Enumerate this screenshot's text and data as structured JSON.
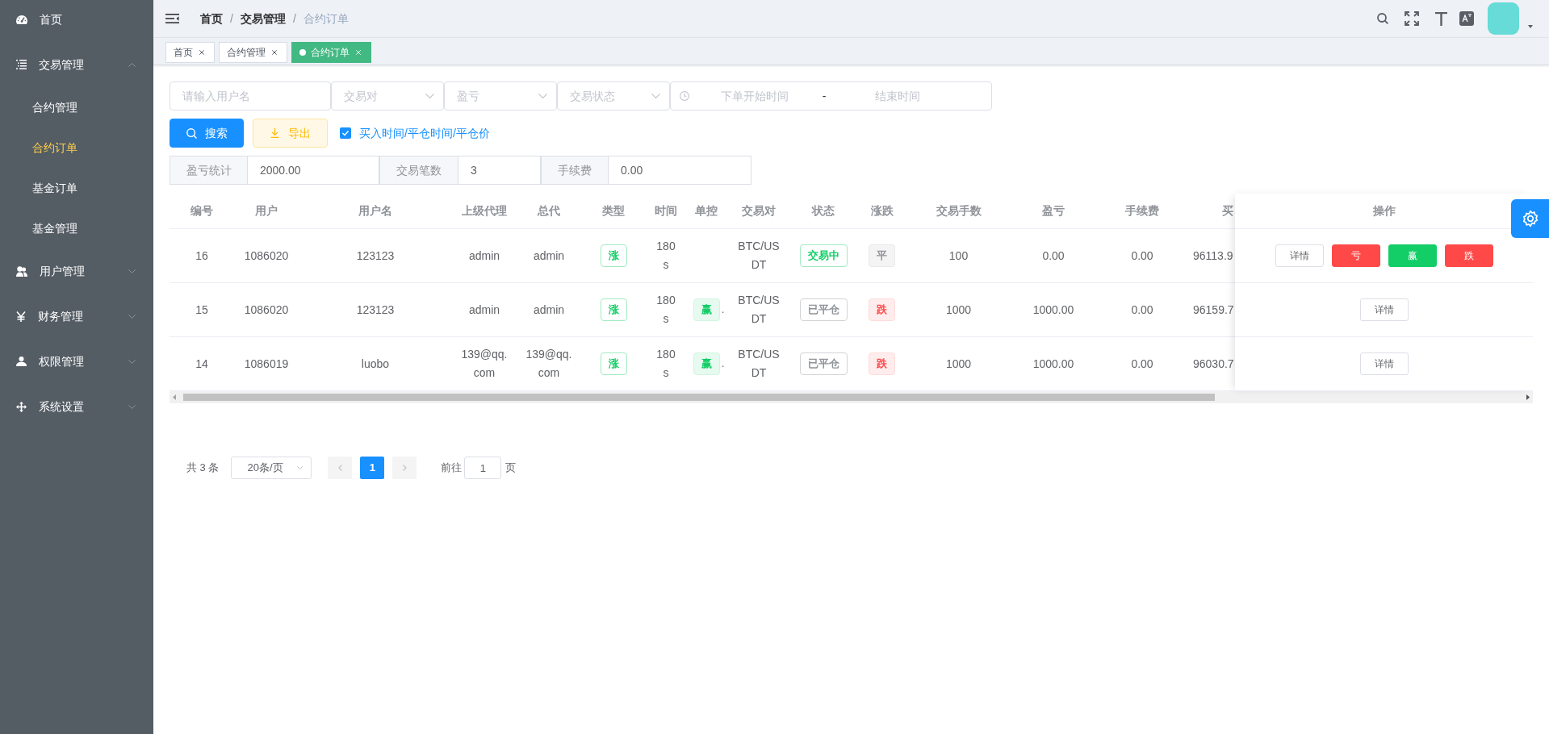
{
  "sidebar": {
    "items": [
      {
        "label": "首页",
        "kind": "item",
        "selected": false
      },
      {
        "label": "交易管理",
        "kind": "submenu",
        "expanded": true,
        "children": [
          {
            "label": "合约管理",
            "selected": false
          },
          {
            "label": "合约订单",
            "selected": true
          },
          {
            "label": "基金订单",
            "selected": false
          },
          {
            "label": "基金管理",
            "selected": false
          }
        ]
      },
      {
        "label": "用户管理",
        "kind": "submenu",
        "expanded": false
      },
      {
        "label": "财务管理",
        "kind": "submenu",
        "expanded": false
      },
      {
        "label": "权限管理",
        "kind": "submenu",
        "expanded": false
      },
      {
        "label": "系统设置",
        "kind": "submenu",
        "expanded": false
      }
    ]
  },
  "navbar": {
    "breadcrumb": [
      {
        "label": "首页"
      },
      {
        "separator": "/",
        "label": "交易管理"
      },
      {
        "separator": "/",
        "label": "合约订单"
      }
    ]
  },
  "tabs": [
    {
      "label": "首页",
      "selected": false
    },
    {
      "label": "合约管理",
      "selected": false
    },
    {
      "label": "合约订单",
      "selected": true
    }
  ],
  "filters": {
    "username": {
      "placeholder": "请输入用户名"
    },
    "selects": [
      {
        "placeholder": "交易对"
      },
      {
        "placeholder": "盈亏"
      },
      {
        "placeholder": "交易状态"
      }
    ],
    "date_range": {
      "start_placeholder": "下单开始时间",
      "separator": "-",
      "end_placeholder": "结束时间"
    }
  },
  "actions": {
    "buttons": [
      {
        "label": "搜索",
        "kind": "primary"
      },
      {
        "label": "导出",
        "kind": "warning"
      }
    ],
    "checkbox": {
      "label": "买入时间/平仓时间/平仓价",
      "checked": true
    }
  },
  "stats": [
    {
      "label": "盈亏统计",
      "value": "2000.00"
    },
    {
      "label": "交易笔数",
      "value": "3"
    },
    {
      "label": "手续费",
      "value": "0.00"
    }
  ],
  "table": {
    "columns": [
      "编号",
      "用户",
      "用户名",
      "上级代理",
      "总代",
      "类型",
      "时间",
      "单控",
      "交易对",
      "状态",
      "涨跌",
      "交易手数",
      "盈亏",
      "手续费",
      "买"
    ],
    "action_column": "操作",
    "rows": [
      {
        "id": "16",
        "user": "1086020",
        "username": "123123",
        "agent": "admin",
        "general_agent": "admin",
        "type": {
          "label": "涨",
          "color": "#13ce66",
          "kind": "plain"
        },
        "time": "180s",
        "pair": "BTC/USDT",
        "status": {
          "label": "交易中",
          "color": "#13ce66",
          "kind": "plain"
        },
        "trend": {
          "label": "平",
          "color": "#909399",
          "kind": "light"
        },
        "lots": "100",
        "profit": "0.00",
        "fee": "0.00",
        "buy_price": "96113.9",
        "actions": [
          {
            "label": "详情",
            "kind": "default"
          },
          {
            "label": "亏",
            "kind": "danger"
          },
          {
            "label": "赢",
            "kind": "success"
          },
          {
            "label": "跌",
            "kind": "danger"
          }
        ]
      },
      {
        "id": "15",
        "user": "1086020",
        "username": "123123",
        "agent": "admin",
        "general_agent": "admin",
        "type": {
          "label": "涨",
          "color": "#13ce66",
          "kind": "plain"
        },
        "time": "180s",
        "control": {
          "label": "赢",
          "color": "#13ce66",
          "kind": "light",
          "suffix": "."
        },
        "pair": "BTC/USDT",
        "status": {
          "label": "已平仓",
          "color": "#909399",
          "kind": "plain"
        },
        "trend": {
          "label": "跌",
          "color": "#ff4949",
          "kind": "light"
        },
        "lots": "1000",
        "profit": "1000.00",
        "fee": "0.00",
        "buy_price": "96159.7",
        "actions": [
          {
            "label": "详情",
            "kind": "default"
          }
        ]
      },
      {
        "id": "14",
        "user": "1086019",
        "username": "luobo",
        "agent": "139@qq.com",
        "general_agent": "139@qq.com",
        "type": {
          "label": "涨",
          "color": "#13ce66",
          "kind": "plain"
        },
        "time": "180s",
        "control": {
          "label": "赢",
          "color": "#13ce66",
          "kind": "light",
          "suffix": "."
        },
        "pair": "BTC/USDT",
        "status": {
          "label": "已平仓",
          "color": "#909399",
          "kind": "plain"
        },
        "trend": {
          "label": "跌",
          "color": "#ff4949",
          "kind": "light"
        },
        "lots": "1000",
        "profit": "1000.00",
        "fee": "0.00",
        "buy_price": "96030.7",
        "actions": [
          {
            "label": "详情",
            "kind": "default"
          }
        ]
      }
    ]
  },
  "pagination": {
    "total": "共 3 条",
    "page_size": "20条/页",
    "pages": [
      {
        "label": "1",
        "selected": true
      }
    ],
    "jump_label": "前往",
    "jump_value": "1",
    "jump_suffix": "页"
  }
}
